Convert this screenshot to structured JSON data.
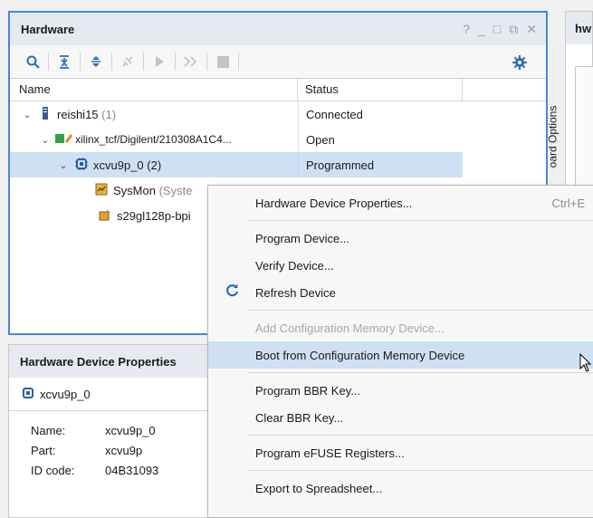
{
  "hardware": {
    "title": "Hardware",
    "controls": [
      "?",
      "_",
      "□",
      "⧉",
      "✕"
    ],
    "toolbar": [
      "search-icon",
      "collapse-all-icon",
      "expand-all-icon",
      "disconnect-icon",
      "run-icon",
      "step-icon",
      "stop-icon"
    ],
    "columns": {
      "name": "Name",
      "status": "Status"
    },
    "rows": [
      {
        "name": "reishi15",
        "count": "(1)",
        "status": "Connected",
        "icon": "server-icon"
      },
      {
        "name": "xilinx_tcf/Digilent/210308A1C4...",
        "count": "",
        "status": "Open",
        "icon": "jtag-cable-icon"
      },
      {
        "name": "xcvu9p_0",
        "count": "(2)",
        "status": "Programmed",
        "icon": "chip-icon"
      },
      {
        "name": "SysMon",
        "count": "(Syste",
        "status": "",
        "icon": "sysmon-icon"
      },
      {
        "name": "s29gl128p-bpi",
        "count": "",
        "status": "",
        "icon": "flash-icon"
      }
    ]
  },
  "right_panel": {
    "title": "hw",
    "vtab": "oard Options"
  },
  "properties": {
    "title": "Hardware Device Properties",
    "device": "xcvu9p_0",
    "rows": [
      {
        "key": "Name:",
        "value": "xcvu9p_0"
      },
      {
        "key": "Part:",
        "value": "xcvu9p"
      },
      {
        "key": "ID code:",
        "value": "04B31093"
      }
    ]
  },
  "context_menu": {
    "items": [
      {
        "label": "Hardware Device Properties...",
        "shortcut": "Ctrl+E"
      },
      {
        "label": "Program Device..."
      },
      {
        "label": "Verify Device..."
      },
      {
        "label": "Refresh Device",
        "icon": "refresh-icon"
      },
      {
        "label": "Add Configuration Memory Device..."
      },
      {
        "label": "Boot from Configuration Memory Device"
      },
      {
        "label": "Program BBR Key..."
      },
      {
        "label": "Clear BBR Key..."
      },
      {
        "label": "Program eFUSE Registers..."
      },
      {
        "label": "Export to Spreadsheet..."
      }
    ]
  },
  "colors": {
    "accent": "#4a86d4",
    "selection": "#cfe0f5",
    "icon_blue": "#2f6db5"
  }
}
